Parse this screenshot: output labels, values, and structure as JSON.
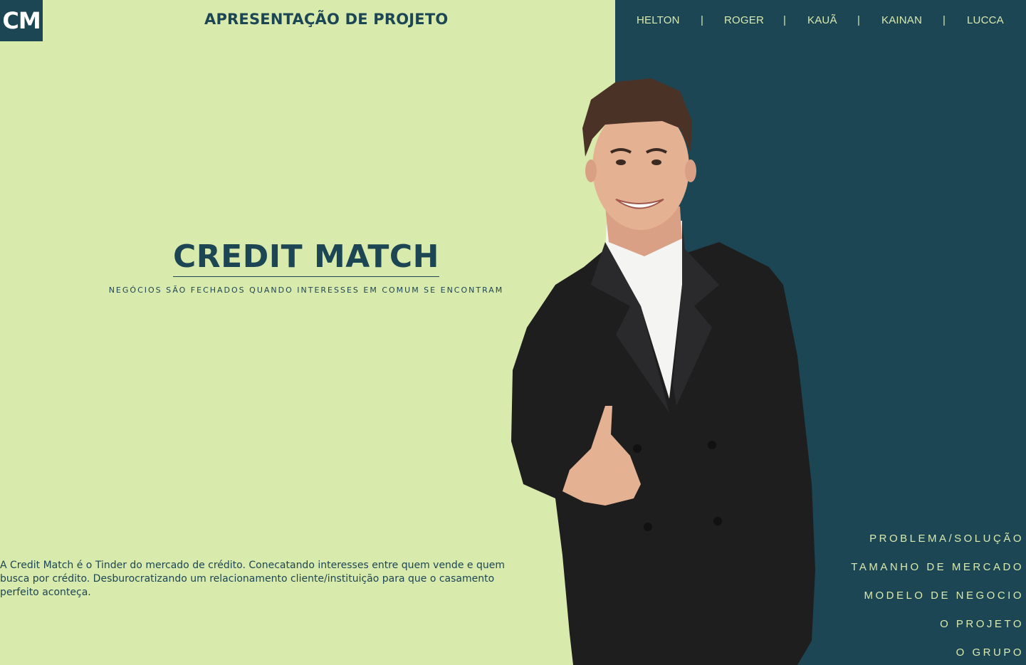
{
  "logo": {
    "text": "CM"
  },
  "header": {
    "title": "APRESENTAÇÃO DE PROJETO"
  },
  "top_nav": {
    "items": [
      "HELTON",
      "ROGER",
      "KAUÃ",
      "KAINAN",
      "LUCCA"
    ],
    "separator": "|"
  },
  "hero": {
    "title": "CREDIT MATCH",
    "subtitle": "NEGÓCIOS SÃO FECHADOS QUANDO INTERESSES EM COMUM SE ENCONTRAM"
  },
  "description": "A Credit Match é o Tinder do mercado de crédito. Conecatando interesses entre quem vende e quem busca por crédito. Desburocratizando um relacionamento cliente/instituição para que o casamento perfeito aconteça.",
  "side_nav": {
    "items": [
      "PROBLEMA/SOLUÇÃO",
      "TAMANHO DE MERCADO",
      "MODELO DE NEGOCIO",
      "O PROJETO",
      "O GRUPO"
    ]
  },
  "colors": {
    "light_green": "#d9eaad",
    "dark_teal": "#1c4654"
  }
}
